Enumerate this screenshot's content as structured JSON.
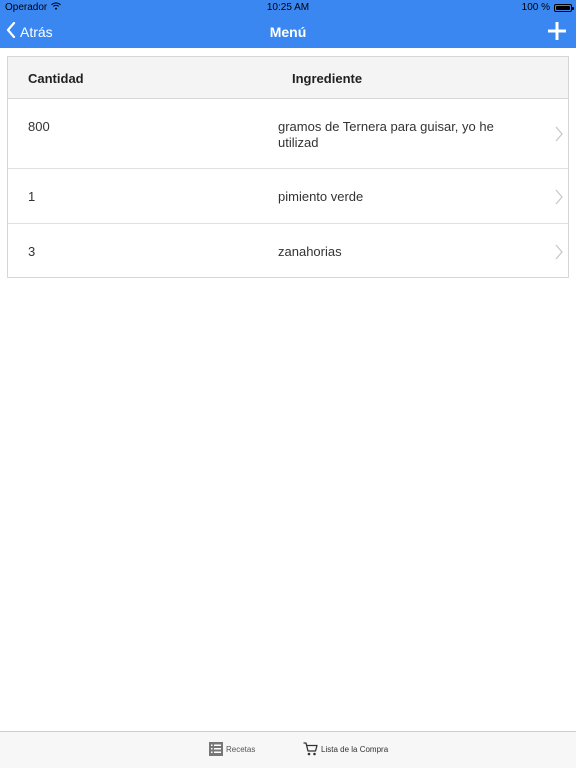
{
  "status_bar": {
    "carrier": "Operador",
    "time": "10:25 AM",
    "battery": "100 %",
    "wifi_icon": "wifi-icon",
    "battery_icon": "battery-icon"
  },
  "nav": {
    "back_label": "Atrás",
    "title": "Menú",
    "add_icon": "plus-icon",
    "back_icon": "chevron-left-icon"
  },
  "table": {
    "headers": {
      "quantity": "Cantidad",
      "ingredient": "Ingrediente"
    },
    "rows": [
      {
        "quantity": "800",
        "ingredient": "gramos de Ternera para guisar, yo he utilizad"
      },
      {
        "quantity": "1",
        "ingredient": "pimiento verde"
      },
      {
        "quantity": "3",
        "ingredient": "zanahorias"
      }
    ]
  },
  "tab_bar": {
    "tabs": [
      {
        "label": "Recetas",
        "icon": "list-icon"
      },
      {
        "label": "Lista de la Compra",
        "icon": "cart-icon"
      }
    ]
  },
  "colors": {
    "accent": "#3a87f2",
    "header_bg": "#f4f4f4",
    "tab_bar_bg": "#f7f7f7"
  }
}
